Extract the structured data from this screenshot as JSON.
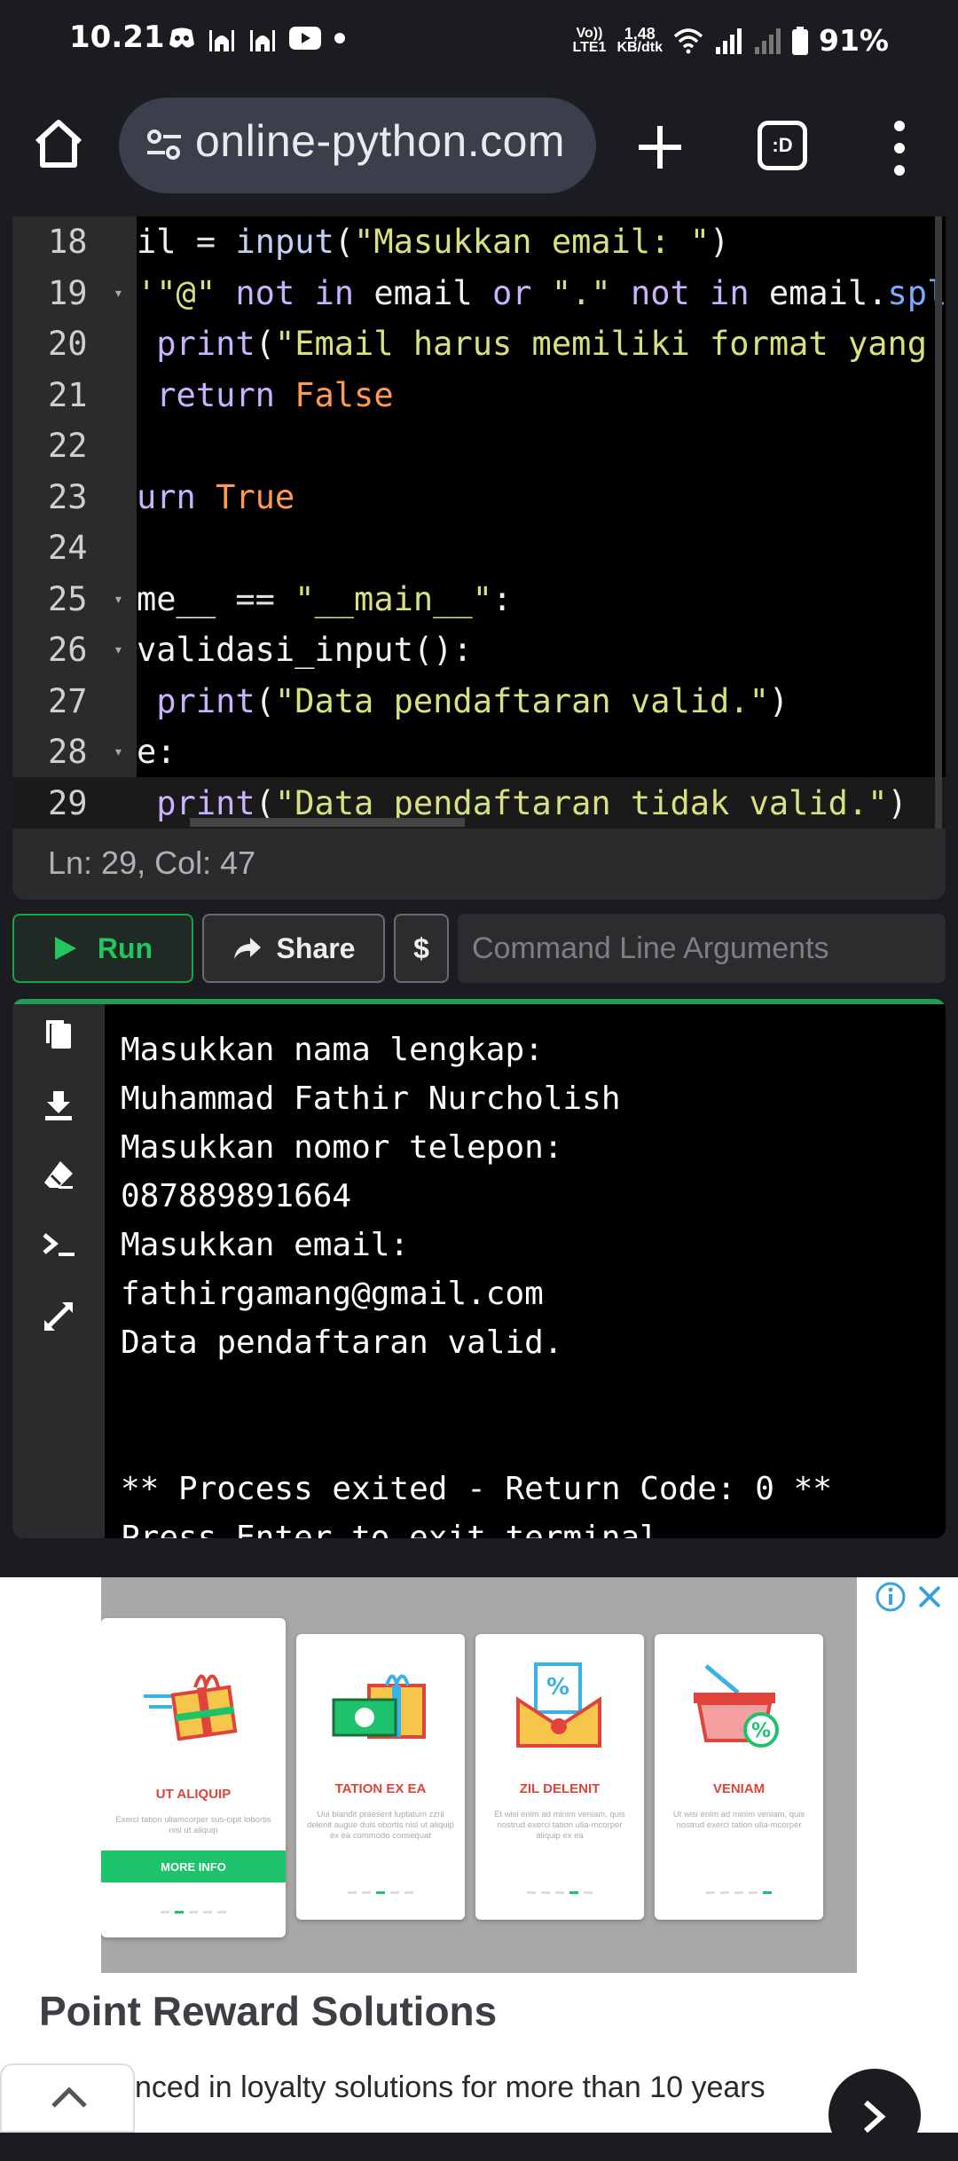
{
  "status_bar": {
    "time": "10.21",
    "network_speed_value": "1,48",
    "network_speed_unit": "KB/dtk",
    "lte_label_top": "Vo))",
    "lte_label_bottom": "LTE1",
    "battery": "91%",
    "notification_icons": [
      "discord-icon",
      "mosque-icon",
      "mosque-icon",
      "youtube-icon",
      "dot-icon"
    ]
  },
  "browser": {
    "url": "online-python.com",
    "tab_switcher_label": ":D"
  },
  "editor": {
    "lines": [
      {
        "num": "18",
        "fold": false,
        "tokens": [
          [
            "pln",
            "il "
          ],
          [
            "op",
            "= "
          ],
          [
            "fn",
            "input"
          ],
          [
            "pln",
            "("
          ],
          [
            "str",
            "\"Masukkan email: \""
          ],
          [
            "pln",
            ")"
          ]
        ]
      },
      {
        "num": "19",
        "fold": true,
        "tokens": [
          [
            "str",
            "'\"@\""
          ],
          [
            "pln",
            " "
          ],
          [
            "kw2",
            "not in"
          ],
          [
            "pln",
            " email "
          ],
          [
            "kw2",
            "or"
          ],
          [
            "pln",
            " "
          ],
          [
            "str",
            "\".\""
          ],
          [
            "pln",
            " "
          ],
          [
            "kw2",
            "not in"
          ],
          [
            "pln",
            " email."
          ],
          [
            "bluefn",
            "spl"
          ]
        ]
      },
      {
        "num": "20",
        "fold": false,
        "tokens": [
          [
            "pln",
            " "
          ],
          [
            "kw2",
            "print"
          ],
          [
            "pln",
            "("
          ],
          [
            "str",
            "\"Email harus memiliki format yang"
          ]
        ]
      },
      {
        "num": "21",
        "fold": false,
        "tokens": [
          [
            "pln",
            " "
          ],
          [
            "kw2",
            "return"
          ],
          [
            "pln",
            " "
          ],
          [
            "kw",
            "False"
          ]
        ]
      },
      {
        "num": "22",
        "fold": false,
        "tokens": []
      },
      {
        "num": "23",
        "fold": false,
        "tokens": [
          [
            "kw2",
            "urn"
          ],
          [
            "pln",
            " "
          ],
          [
            "kw",
            "True"
          ]
        ]
      },
      {
        "num": "24",
        "fold": false,
        "tokens": []
      },
      {
        "num": "25",
        "fold": true,
        "tokens": [
          [
            "pln",
            "me__ "
          ],
          [
            "op",
            "== "
          ],
          [
            "str",
            "\"__main__\""
          ],
          [
            "pln",
            ":"
          ]
        ]
      },
      {
        "num": "26",
        "fold": true,
        "tokens": [
          [
            "pln",
            "validasi_input():"
          ]
        ]
      },
      {
        "num": "27",
        "fold": false,
        "tokens": [
          [
            "pln",
            " "
          ],
          [
            "kw2",
            "print"
          ],
          [
            "pln",
            "("
          ],
          [
            "str",
            "\"Data pendaftaran valid.\""
          ],
          [
            "pln",
            ")"
          ]
        ]
      },
      {
        "num": "28",
        "fold": true,
        "tokens": [
          [
            "pln",
            "e:"
          ]
        ]
      },
      {
        "num": "29",
        "fold": false,
        "tokens": [
          [
            "pln",
            " "
          ],
          [
            "kw2",
            "print"
          ],
          [
            "pln",
            "("
          ],
          [
            "str",
            "\"Data pendaftaran tidak valid.\""
          ],
          [
            "pln",
            ")"
          ]
        ]
      }
    ],
    "cursor_status": "Ln: 29,  Col: 47"
  },
  "actions": {
    "run_label": "Run",
    "share_label": "Share",
    "dollar_label": "$",
    "args_placeholder": "Command Line Arguments"
  },
  "terminal": {
    "output": "Masukkan nama lengkap:\nMuhammad Fathir Nurcholish\nMasukkan nomor telepon:\n087889891664\nMasukkan email:\nfathirgamang@gmail.com\nData pendaftaran valid.\n\n\n** Process exited - Return Code: 0 **\nPress Enter to exit terminal",
    "side_icons": [
      "copy-icon",
      "download-icon",
      "eraser-icon",
      "terminal-prompt-icon",
      "expand-icon"
    ]
  },
  "ad": {
    "cards": [
      {
        "title": "UT ALIQUIP",
        "desc": "Exerci tation ullamcorper sus-cipit lobortis nisl ut aliquip",
        "button": "MORE INFO",
        "active_dot": 1
      },
      {
        "title": "TATION EX EA",
        "desc": "Uui blandit praesent luptatum zzril delenit augue duis obortis nisl ut aliquip ex ea commodo consequat",
        "active_dot": 2
      },
      {
        "title": "ZIL DELENIT",
        "desc": "Et wisi enim ad minim veniam, quis nostrud exerci tation ulla-mcorper aliquip ex ea",
        "active_dot": 3
      },
      {
        "title": "VENIAM",
        "desc": "Ut wisi enim ad minim veniam, quis nostrud exerci tation ulla-mcorper",
        "active_dot": 4
      }
    ],
    "title": "Point Reward Solutions",
    "subtitle": "nced in loyalty solutions for more than 10 years"
  }
}
